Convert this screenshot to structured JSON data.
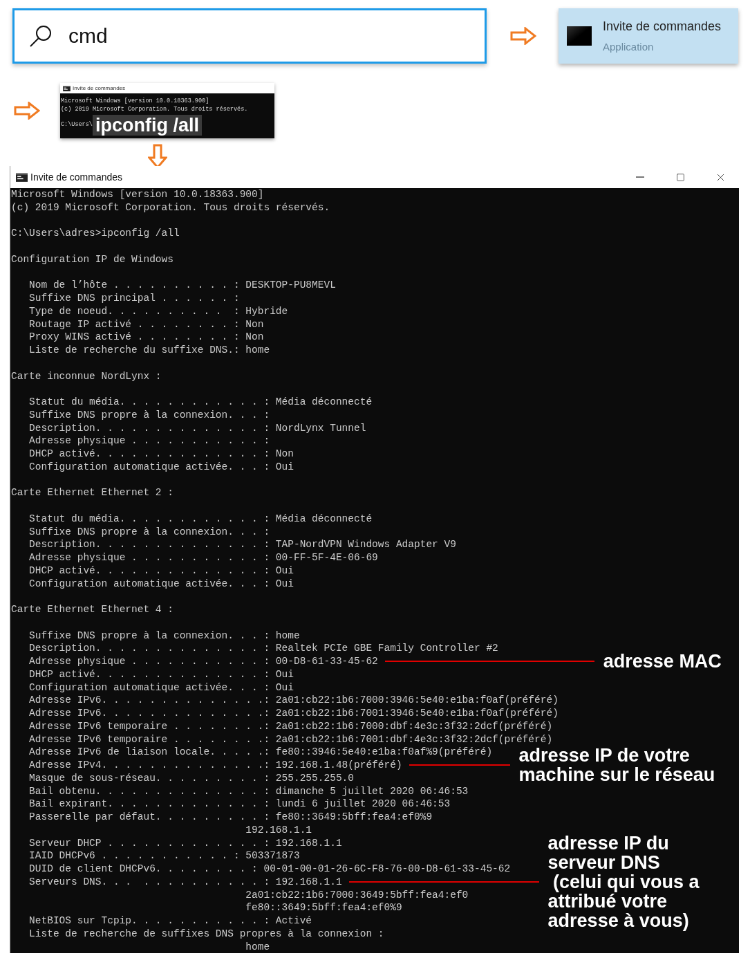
{
  "search": {
    "value": "cmd"
  },
  "result": {
    "title": "Invite de commandes",
    "subtitle": "Application"
  },
  "inset": {
    "title": "Invite de commandes",
    "lines": [
      "Microsoft Windows [version 10.0.18363.900]",
      "(c) 2019 Microsoft Corporation. Tous droits réservés."
    ],
    "prompt": "C:\\Users\\",
    "command": "ipconfig /all"
  },
  "window": {
    "title": "Invite de commandes",
    "blocks": [
      [
        {
          "text": "Microsoft Windows [version 10.0.18363.900]"
        },
        {
          "text": "(c) 2019 Microsoft Corporation. Tous droits réservés."
        }
      ],
      [
        {
          "text": "C:\\Users\\adres>ipconfig /all"
        }
      ],
      [
        {
          "text": "Configuration IP de Windows"
        }
      ],
      [
        {
          "text": "   Nom de l’hôte . . . . . . . . . . : DESKTOP-PU8MEVL"
        },
        {
          "text": "   Suffixe DNS principal . . . . . . :"
        },
        {
          "text": "   Type de noeud. . . . . . . . . .  : Hybride"
        },
        {
          "text": "   Routage IP activé . . . . . . . . : Non"
        },
        {
          "text": "   Proxy WINS activé . . . . . . . . : Non"
        },
        {
          "text": "   Liste de recherche du suffixe DNS.: home"
        }
      ],
      [
        {
          "text": "Carte inconnue NordLynx :"
        }
      ],
      [
        {
          "text": "   Statut du média. . . . . . . . . . . . : Média déconnecté"
        },
        {
          "text": "   Suffixe DNS propre à la connexion. . . :"
        },
        {
          "text": "   Description. . . . . . . . . . . . . . : NordLynx Tunnel"
        },
        {
          "text": "   Adresse physique . . . . . . . . . . . :"
        },
        {
          "text": "   DHCP activé. . . . . . . . . . . . . . : Non"
        },
        {
          "text": "   Configuration automatique activée. . . : Oui"
        }
      ],
      [
        {
          "text": "Carte Ethernet Ethernet 2 :"
        }
      ],
      [
        {
          "text": "   Statut du média. . . . . . . . . . . . : Média déconnecté"
        },
        {
          "text": "   Suffixe DNS propre à la connexion. . . :"
        },
        {
          "text": "   Description. . . . . . . . . . . . . . : TAP-NordVPN Windows Adapter V9"
        },
        {
          "text": "   Adresse physique . . . . . . . . . . . : 00-FF-5F-4E-06-69"
        },
        {
          "text": "   DHCP activé. . . . . . . . . . . . . . : Oui"
        },
        {
          "text": "   Configuration automatique activée. . . : Oui"
        }
      ],
      [
        {
          "text": "Carte Ethernet Ethernet 4 :"
        }
      ],
      [
        {
          "text": "   Suffixe DNS propre à la connexion. . . : home"
        },
        {
          "text": "   Description. . . . . . . . . . . . . . : Realtek PCIe GBE Family Controller #2"
        },
        {
          "text": "   Adresse physique . . . . . . . . . . . : 00-D8-61-33-45-62",
          "note": "adresse MAC"
        },
        {
          "text": "   DHCP activé. . . . . . . . . . . . . . : Oui"
        },
        {
          "text": "   Configuration automatique activée. . . : Oui"
        },
        {
          "text": "   Adresse IPv6. . . . . . . . . . . . . .: 2a01:cb22:1b6:7000:3946:5e40:e1ba:f0af(préféré)"
        },
        {
          "text": "   Adresse IPv6. . . . . . . . . . . . . .: 2a01:cb22:1b6:7001:3946:5e40:e1ba:f0af(préféré)"
        },
        {
          "text": "   Adresse IPv6 temporaire . . . . . . . .: 2a01:cb22:1b6:7000:dbf:4e3c:3f32:2dcf(préféré)"
        },
        {
          "text": "   Adresse IPv6 temporaire . . . . . . . .: 2a01:cb22:1b6:7001:dbf:4e3c:3f32:2dcf(préféré)"
        },
        {
          "text": "   Adresse IPv6 de liaison locale. . . . .: fe80::3946:5e40:e1ba:f0af%9(préféré)"
        },
        {
          "text": "   Adresse IPv4. . . . . . . . . . . . . .: 192.168.1.48(préféré)",
          "note": "adresse IP de votre\nmachine sur le réseau"
        },
        {
          "text": "   Masque de sous-réseau. . . . . . . . . : 255.255.255.0"
        },
        {
          "text": "   Bail obtenu. . . . . . . . . . . . . . : dimanche 5 juillet 2020 06:46:53"
        },
        {
          "text": "   Bail expirant. . . . . . . . . . . . . : lundi 6 juillet 2020 06:46:53"
        },
        {
          "text": "   Passerelle par défaut. . . . . . . . . : fe80::3649:5bff:fea4:ef0%9"
        },
        {
          "text": "                                       192.168.1.1"
        },
        {
          "text": "   Serveur DHCP . . . . . . . . . . . . . : 192.168.1.1"
        },
        {
          "text": "   IAID DHCPv6 . . . . . . . . . . . : 503371873"
        },
        {
          "text": "   DUID de client DHCPv6. . . . . . . . : 00-01-00-01-26-6C-F8-76-00-D8-61-33-45-62"
        },
        {
          "text": "   Serveurs DNS. . .  . . . . . . . . . . : 192.168.1.1",
          "note": "adresse IP du\nserveur DNS\n (celui qui vous a\nattribué votre\nadresse à vous)"
        },
        {
          "text": "                                       2a01:cb22:1b6:7000:3649:5bff:fea4:ef0"
        },
        {
          "text": "                                       fe80::3649:5bff:fea4:ef0%9"
        },
        {
          "text": "   NetBIOS sur Tcpip. . . . . . . . . . . : Activé"
        },
        {
          "text": "   Liste de recherche de suffixes DNS propres à la connexion :"
        },
        {
          "text": "                                       home"
        }
      ]
    ]
  }
}
